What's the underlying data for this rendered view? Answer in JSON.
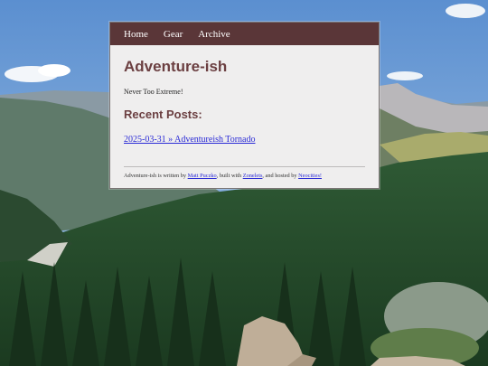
{
  "nav": {
    "items": [
      {
        "label": "Home"
      },
      {
        "label": "Gear"
      },
      {
        "label": "Archive"
      }
    ]
  },
  "site": {
    "title": "Adventure-ish",
    "tagline": "Never Too Extreme!"
  },
  "recent": {
    "heading": "Recent Posts:",
    "posts": [
      {
        "label": "2025-03-31 » Adventureish Tornado"
      }
    ]
  },
  "footer": {
    "text1": "Adventure-ish is written by ",
    "author": "Matt Puczko",
    "text2": ", built with ",
    "builder": "Zonelets",
    "text3": ", and hosted by ",
    "host": "Neocities!"
  },
  "colors": {
    "nav_bg": "#5a3638",
    "heading": "#6b3f41",
    "link": "#2a2ad6",
    "card_bg": "#efeeee"
  }
}
